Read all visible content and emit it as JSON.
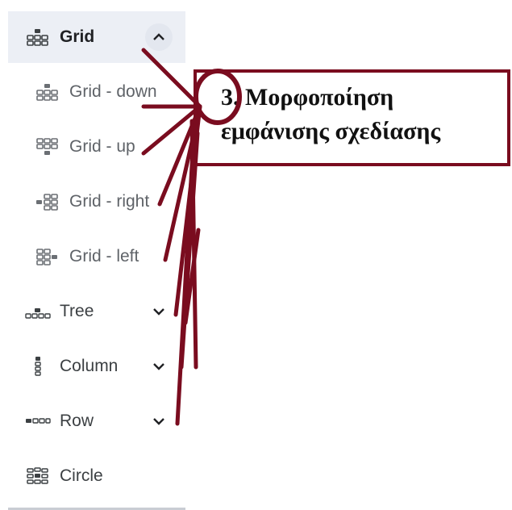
{
  "menu": {
    "items": [
      {
        "label": "Grid",
        "icon": "grid-icon",
        "expanded": true,
        "active": true
      },
      {
        "label": "Grid - down",
        "icon": "grid-down-icon",
        "sub": true
      },
      {
        "label": "Grid - up",
        "icon": "grid-up-icon",
        "sub": true
      },
      {
        "label": "Grid - right",
        "icon": "grid-right-icon",
        "sub": true
      },
      {
        "label": "Grid - left",
        "icon": "grid-left-icon",
        "sub": true
      },
      {
        "label": "Tree",
        "icon": "tree-icon",
        "expanded": false
      },
      {
        "label": "Column",
        "icon": "column-icon",
        "expanded": false
      },
      {
        "label": "Row",
        "icon": "row-icon",
        "expanded": false
      },
      {
        "label": "Circle",
        "icon": "circle-icon"
      }
    ]
  },
  "annotation": {
    "text": "3. Μορφοποίηση\nεμφάνισης σχεδίασης",
    "color": "#7a0c1f"
  }
}
